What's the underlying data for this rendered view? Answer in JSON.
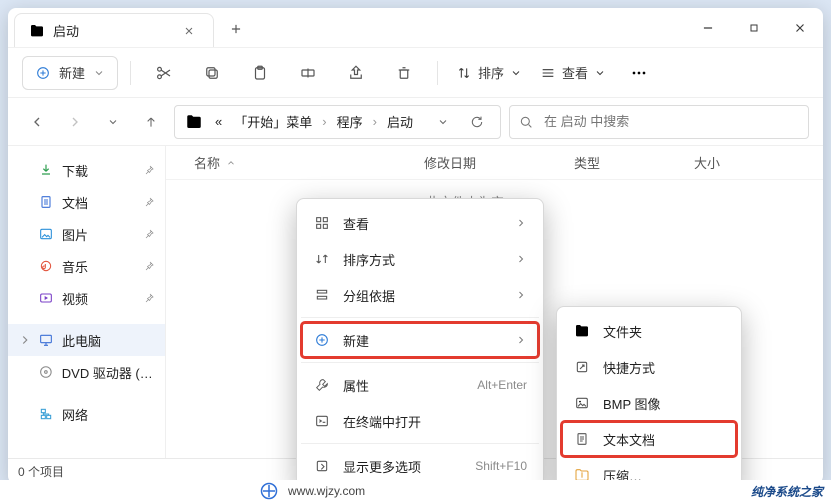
{
  "titlebar": {
    "tab_label": "启动"
  },
  "toolbar": {
    "new_label": "新建",
    "sort_label": "排序",
    "view_label": "查看"
  },
  "breadcrumbs": {
    "prefix": "«",
    "a": "「开始」菜单",
    "b": "程序",
    "c": "启动"
  },
  "search": {
    "placeholder": "在 启动 中搜索"
  },
  "sidebar": {
    "downloads": "下载",
    "documents": "文档",
    "pictures": "图片",
    "music": "音乐",
    "videos": "视频",
    "thispc": "此电脑",
    "dvd": "DVD 驱动器 (P:)",
    "network": "网络"
  },
  "columns": {
    "name": "名称",
    "mod": "修改日期",
    "type": "类型",
    "size": "大小"
  },
  "empty_hint": "此文件夹为空",
  "status": {
    "items": "0 个项目"
  },
  "context_menu": {
    "view": "查看",
    "sort_by": "排序方式",
    "group_by": "分组依据",
    "new": "新建",
    "properties": "属性",
    "open_terminal": "在终端中打开",
    "more_options": "显示更多选项",
    "kbd_properties": "Alt+Enter",
    "kbd_more": "Shift+F10"
  },
  "new_submenu": {
    "folder": "文件夹",
    "shortcut": "快捷方式",
    "bmp": "BMP 图像",
    "text": "文本文档",
    "zip": "压缩…"
  },
  "watermark": {
    "url": "www.wjzy.com",
    "brand": "纯净系统之家"
  }
}
